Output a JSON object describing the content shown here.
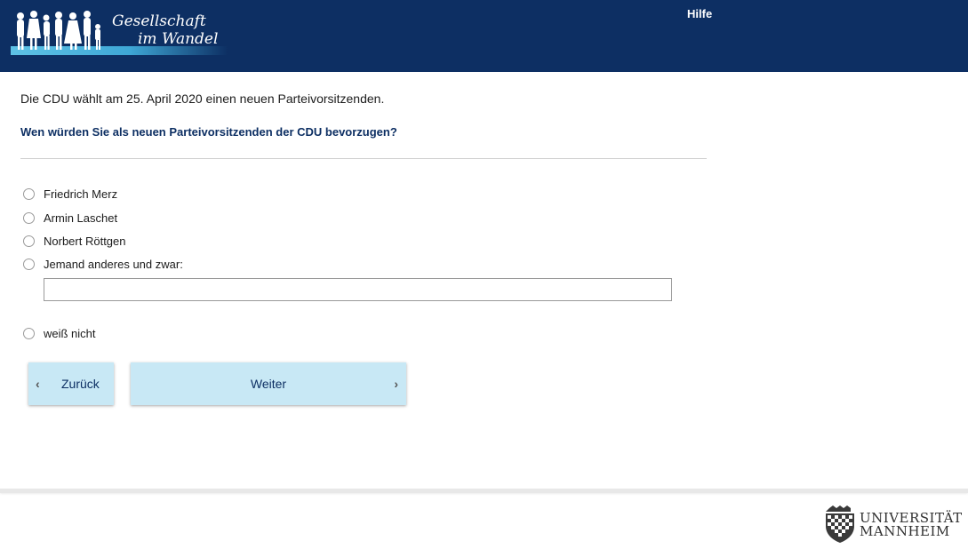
{
  "header": {
    "logo_line1": "Gesellschaft",
    "logo_line2": "im Wandel",
    "help_label": "Hilfe"
  },
  "survey": {
    "intro": "Die CDU wählt am 25. April 2020 einen neuen Parteivorsitzenden.",
    "question": "Wen würden Sie als neuen Parteivorsitzenden der CDU bevorzugen?",
    "options": [
      "Friedrich Merz",
      "Armin Laschet",
      "Norbert Röttgen",
      "Jemand anderes und zwar:",
      "weiß nicht"
    ],
    "other_value": ""
  },
  "nav": {
    "back_label": "Zurück",
    "next_label": "Weiter"
  },
  "footer": {
    "uni_line1": "UNIVERSITÄT",
    "uni_line2": "MANNHEIM"
  },
  "colors": {
    "header_bg": "#0d2f63",
    "button_bg": "#c8e8f5"
  }
}
